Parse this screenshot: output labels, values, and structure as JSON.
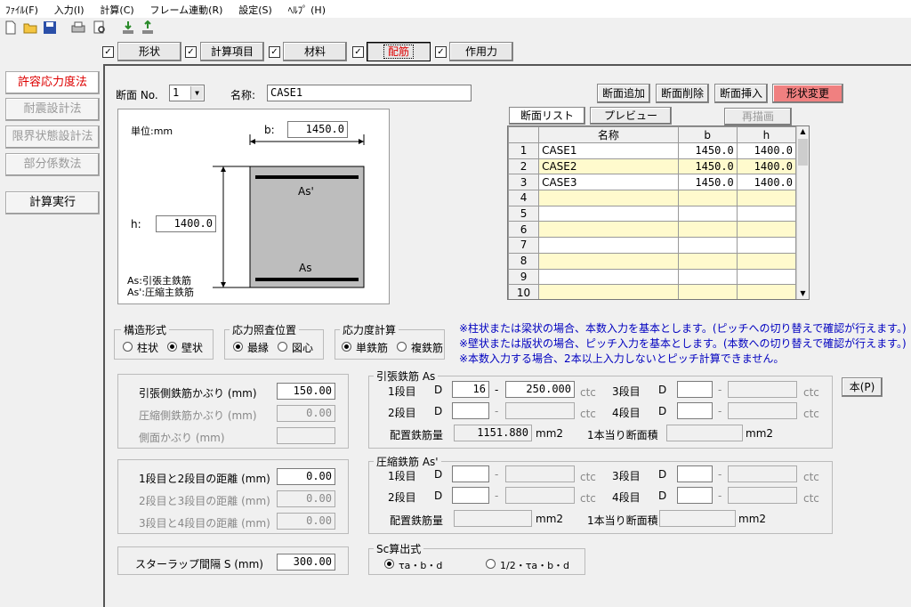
{
  "menu": [
    "ﾌｧｲﾙ(F)",
    "入力(I)",
    "計算(C)",
    "フレーム連動(R)",
    "設定(S)",
    "ﾍﾙﾌﾟ (H)"
  ],
  "toolbar_icons": [
    "new-file-icon",
    "open-folder-icon",
    "save-icon",
    "print-icon",
    "print-preview-icon",
    "import-icon",
    "export-icon"
  ],
  "tabs": [
    {
      "label": "形状",
      "checked": "✓"
    },
    {
      "label": "計算項目",
      "checked": "✓"
    },
    {
      "label": "材料",
      "checked": "✓"
    },
    {
      "label": "配筋",
      "checked": "✓"
    },
    {
      "label": "作用力",
      "checked": "✓"
    }
  ],
  "left_nav": [
    "許容応力度法",
    "耐震設計法",
    "限界状態設計法",
    "部分係数法",
    "計算実行"
  ],
  "section": {
    "no_label": "断面 No.",
    "no_value": "1",
    "name_label": "名称:",
    "name_value": "CASE1"
  },
  "section_buttons": [
    "断面追加",
    "断面削除",
    "断面挿入",
    "形状変更"
  ],
  "diagram": {
    "unit": "単位:mm",
    "b_label": "b:",
    "b_value": "1450.0",
    "h_label": "h:",
    "h_value": "1400.0",
    "as_top": "As'",
    "as_bottom": "As",
    "legend1": "As:引張主鉄筋",
    "legend2": "As':圧縮主鉄筋"
  },
  "list_tabs": {
    "list": "断面リスト",
    "preview": "プレビュー",
    "redraw": "再描画"
  },
  "list_headers": [
    "名称",
    "b",
    "h"
  ],
  "list_rows": [
    {
      "n": "1",
      "name": "CASE1",
      "b": "1450.0",
      "h": "1400.0"
    },
    {
      "n": "2",
      "name": "CASE2",
      "b": "1450.0",
      "h": "1400.0"
    },
    {
      "n": "3",
      "name": "CASE3",
      "b": "1450.0",
      "h": "1400.0"
    },
    {
      "n": "4",
      "name": "",
      "b": "",
      "h": ""
    },
    {
      "n": "5",
      "name": "",
      "b": "",
      "h": ""
    },
    {
      "n": "6",
      "name": "",
      "b": "",
      "h": ""
    },
    {
      "n": "7",
      "name": "",
      "b": "",
      "h": ""
    },
    {
      "n": "8",
      "name": "",
      "b": "",
      "h": ""
    },
    {
      "n": "9",
      "name": "",
      "b": "",
      "h": ""
    },
    {
      "n": "10",
      "name": "",
      "b": "",
      "h": ""
    }
  ],
  "struct_form": {
    "title": "構造形式",
    "opt1": "柱状",
    "opt2": "壁状"
  },
  "stress_pos": {
    "title": "応力照査位置",
    "opt1": "最縁",
    "opt2": "図心"
  },
  "stress_calc": {
    "title": "応力度計算",
    "opt1": "単鉄筋",
    "opt2": "複鉄筋"
  },
  "notes": [
    "※柱状または梁状の場合、本数入力を基本とします。(ピッチへの切り替えで確認が行えます。)",
    "※壁状または版状の場合、ピッチ入力を基本とします。(本数への切り替えで確認が行えます。)",
    "※本数入力する場合、2本以上入力しないとピッチ計算できません。"
  ],
  "cover": {
    "tension_label": "引張側鉄筋かぶり (mm)",
    "tension_value": "150.00",
    "comp_label": "圧縮側鉄筋かぶり (mm)",
    "comp_value": "0.00",
    "side_label": "側面かぶり (mm)",
    "side_value": ""
  },
  "dist": {
    "d12_label": "1段目と2段目の距離 (mm)",
    "d12_value": "0.00",
    "d23_label": "2段目と3段目の距離 (mm)",
    "d23_value": "0.00",
    "d34_label": "3段目と4段目の距離 (mm)",
    "d34_value": "0.00"
  },
  "stirrup": {
    "label": "スターラップ間隔 S (mm)",
    "value": "300.00"
  },
  "tension_rebar": {
    "title": "引張鉄筋 As",
    "row1": "1段目",
    "row2": "2段目",
    "row3": "3段目",
    "row4": "4段目",
    "d": "D",
    "dash": "-",
    "ctc": "ctc",
    "r1_d": "16",
    "r1_ctc": "250.000",
    "area_label": "配置鉄筋量",
    "area_value": "1151.880",
    "area_unit": "mm2",
    "single_label": "1本当り断面積",
    "single_unit": "mm2"
  },
  "comp_rebar": {
    "title": "圧縮鉄筋 As'",
    "row1": "1段目",
    "row2": "2段目",
    "row3": "3段目",
    "row4": "4段目",
    "d": "D",
    "dash": "-",
    "ctc": "ctc",
    "area_label": "配置鉄筋量",
    "area_unit": "mm2",
    "single_label": "1本当り断面積",
    "single_unit": "mm2"
  },
  "pitch_button": "本(P)",
  "sc_formula": {
    "title": "Sc算出式",
    "opt1": "τa・b・d",
    "opt2": "1/2・τa・b・d"
  },
  "colors": {
    "highlight_row": "#fffacd",
    "active_red": "#dd0000",
    "note_blue": "#0000c0",
    "shape_button": "#f08080"
  }
}
